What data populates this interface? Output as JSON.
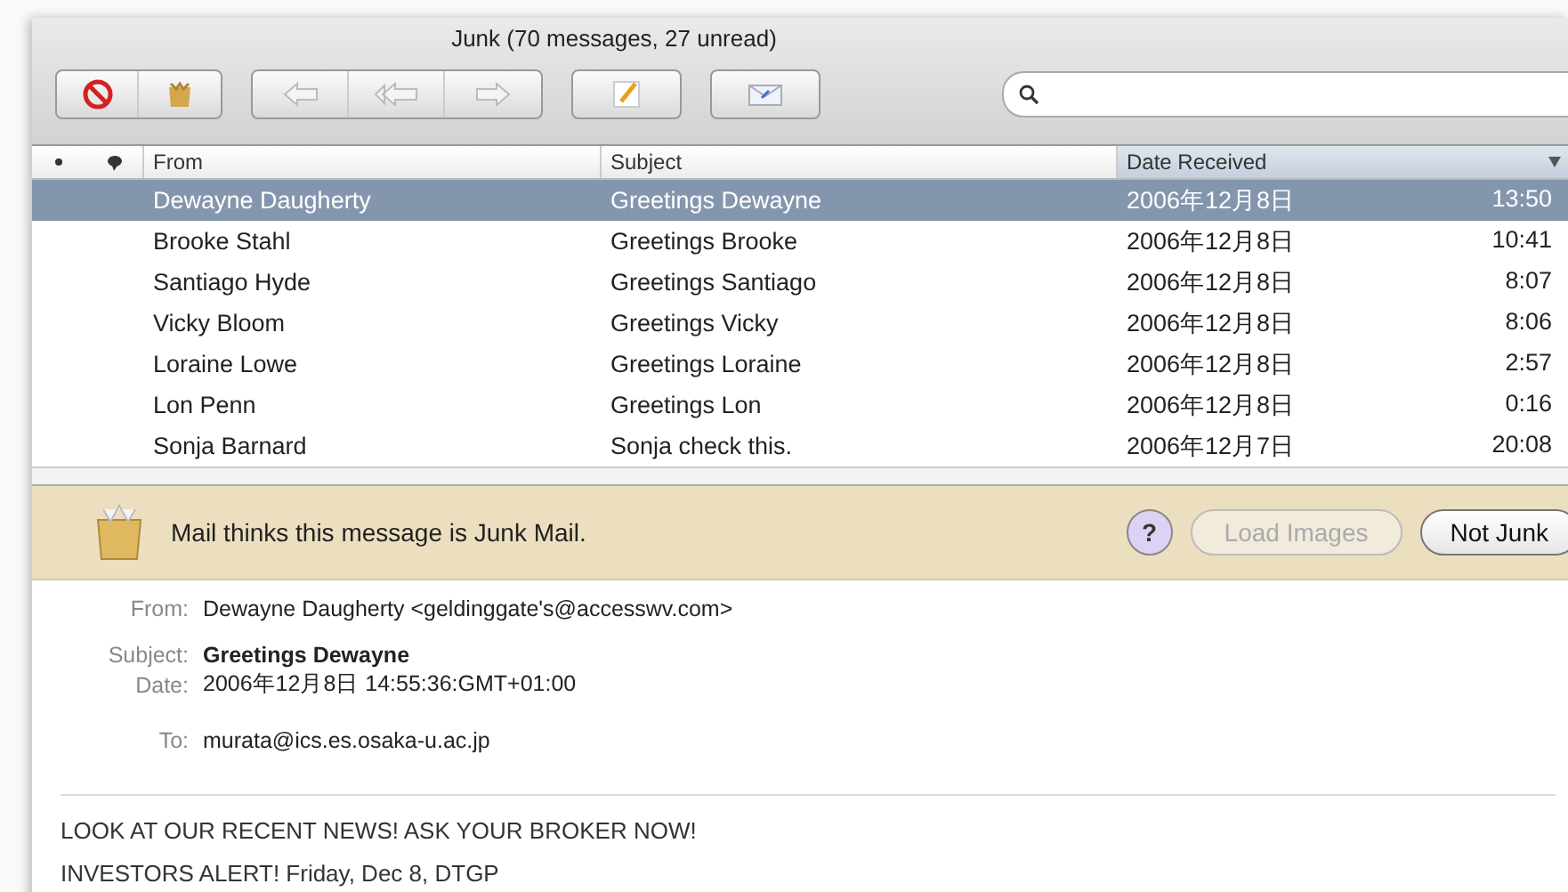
{
  "window": {
    "title": "Junk (70 messages, 27 unread)"
  },
  "table": {
    "columns": [
      {
        "label": "From",
        "selected": false
      },
      {
        "label": "Subject",
        "selected": false
      },
      {
        "label": "Date Received",
        "selected": true
      }
    ],
    "rows": [
      {
        "from": "Dewayne Daugherty",
        "subject": "Greetings Dewayne",
        "date": "2006年12月8日",
        "time": "13:50",
        "selected": true
      },
      {
        "from": "Brooke Stahl",
        "subject": "Greetings Brooke",
        "date": "2006年12月8日",
        "time": "10:41",
        "selected": false
      },
      {
        "from": "Santiago Hyde",
        "subject": "Greetings Santiago",
        "date": "2006年12月8日",
        "time": "8:07",
        "selected": false
      },
      {
        "from": "Vicky Bloom",
        "subject": "Greetings Vicky",
        "date": "2006年12月8日",
        "time": "8:06",
        "selected": false
      },
      {
        "from": "Loraine Lowe",
        "subject": "Greetings Loraine",
        "date": "2006年12月8日",
        "time": "2:57",
        "selected": false
      },
      {
        "from": "Lon Penn",
        "subject": "Greetings Lon",
        "date": "2006年12月8日",
        "time": "0:16",
        "selected": false
      },
      {
        "from": "Sonja Barnard",
        "subject": "Sonja check this.",
        "date": "2006年12月7日",
        "time": "20:08",
        "selected": false
      }
    ]
  },
  "junk_banner": {
    "message": "Mail thinks this message is Junk Mail.",
    "help": "?",
    "buttons": [
      {
        "label": "Load Images",
        "disabled": true
      },
      {
        "label": "Not Junk",
        "disabled": false
      }
    ]
  },
  "headers": [
    {
      "label": "From:",
      "value": "Dewayne Daugherty <geldinggate's@accesswv.com>",
      "bold": false
    },
    {
      "label": "Subject:",
      "value": "Greetings Dewayne",
      "bold": true
    },
    {
      "label": "Date:",
      "value": "2006年12月8日 14:55:36:GMT+01:00",
      "bold": false
    },
    {
      "label": "To:",
      "value": "murata@ics.es.osaka-u.ac.jp",
      "bold": false
    }
  ],
  "body": [
    "LOOK AT OUR RECENT NEWS! ASK YOUR BROKER NOW!",
    "INVESTORS ALERT! Friday, Dec 8, DTGP"
  ]
}
